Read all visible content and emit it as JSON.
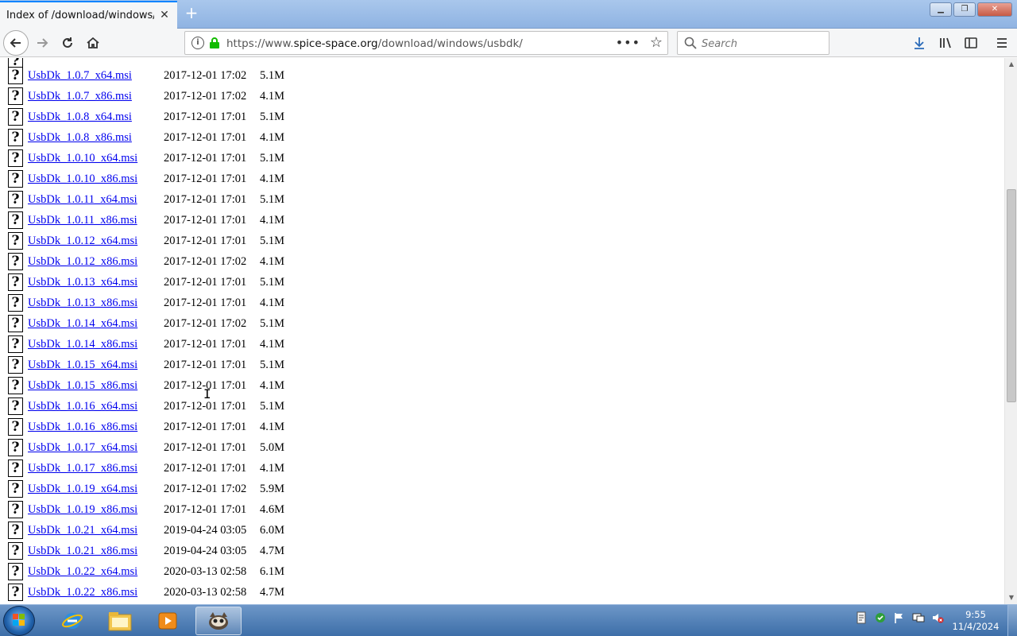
{
  "browser": {
    "tab_title": "Index of /download/windows/usbdk",
    "url_prefix": "https://www.",
    "url_domain": "spice-space.org",
    "url_path": "/download/windows/usbdk/",
    "search_placeholder": "Search"
  },
  "files": [
    {
      "name": "UsbDk_1.0.7_x64.msi",
      "date": "2017-12-01 17:02",
      "size": "5.1M"
    },
    {
      "name": "UsbDk_1.0.7_x86.msi",
      "date": "2017-12-01 17:02",
      "size": "4.1M"
    },
    {
      "name": "UsbDk_1.0.8_x64.msi",
      "date": "2017-12-01 17:01",
      "size": "5.1M"
    },
    {
      "name": "UsbDk_1.0.8_x86.msi",
      "date": "2017-12-01 17:01",
      "size": "4.1M"
    },
    {
      "name": "UsbDk_1.0.10_x64.msi",
      "date": "2017-12-01 17:01",
      "size": "5.1M"
    },
    {
      "name": "UsbDk_1.0.10_x86.msi",
      "date": "2017-12-01 17:01",
      "size": "4.1M"
    },
    {
      "name": "UsbDk_1.0.11_x64.msi",
      "date": "2017-12-01 17:01",
      "size": "5.1M"
    },
    {
      "name": "UsbDk_1.0.11_x86.msi",
      "date": "2017-12-01 17:01",
      "size": "4.1M"
    },
    {
      "name": "UsbDk_1.0.12_x64.msi",
      "date": "2017-12-01 17:01",
      "size": "5.1M"
    },
    {
      "name": "UsbDk_1.0.12_x86.msi",
      "date": "2017-12-01 17:02",
      "size": "4.1M"
    },
    {
      "name": "UsbDk_1.0.13_x64.msi",
      "date": "2017-12-01 17:01",
      "size": "5.1M"
    },
    {
      "name": "UsbDk_1.0.13_x86.msi",
      "date": "2017-12-01 17:01",
      "size": "4.1M"
    },
    {
      "name": "UsbDk_1.0.14_x64.msi",
      "date": "2017-12-01 17:02",
      "size": "5.1M"
    },
    {
      "name": "UsbDk_1.0.14_x86.msi",
      "date": "2017-12-01 17:01",
      "size": "4.1M"
    },
    {
      "name": "UsbDk_1.0.15_x64.msi",
      "date": "2017-12-01 17:01",
      "size": "5.1M"
    },
    {
      "name": "UsbDk_1.0.15_x86.msi",
      "date": "2017-12-01 17:01",
      "size": "4.1M"
    },
    {
      "name": "UsbDk_1.0.16_x64.msi",
      "date": "2017-12-01 17:01",
      "size": "5.1M"
    },
    {
      "name": "UsbDk_1.0.16_x86.msi",
      "date": "2017-12-01 17:01",
      "size": "4.1M"
    },
    {
      "name": "UsbDk_1.0.17_x64.msi",
      "date": "2017-12-01 17:01",
      "size": "5.0M"
    },
    {
      "name": "UsbDk_1.0.17_x86.msi",
      "date": "2017-12-01 17:01",
      "size": "4.1M"
    },
    {
      "name": "UsbDk_1.0.19_x64.msi",
      "date": "2017-12-01 17:02",
      "size": "5.9M"
    },
    {
      "name": "UsbDk_1.0.19_x86.msi",
      "date": "2017-12-01 17:01",
      "size": "4.6M"
    },
    {
      "name": "UsbDk_1.0.21_x64.msi",
      "date": "2019-04-24 03:05",
      "size": "6.0M"
    },
    {
      "name": "UsbDk_1.0.21_x86.msi",
      "date": "2019-04-24 03:05",
      "size": "4.7M"
    },
    {
      "name": "UsbDk_1.0.22_x64.msi",
      "date": "2020-03-13 02:58",
      "size": "6.1M"
    },
    {
      "name": "UsbDk_1.0.22_x86.msi",
      "date": "2020-03-13 02:58",
      "size": "4.7M"
    }
  ],
  "taskbar": {
    "clock_time": "9:55",
    "clock_date": "11/4/2024"
  },
  "colors": {
    "link": "#0000ee",
    "tab_accent": "#0a84ff",
    "lock_green": "#12bc00"
  }
}
